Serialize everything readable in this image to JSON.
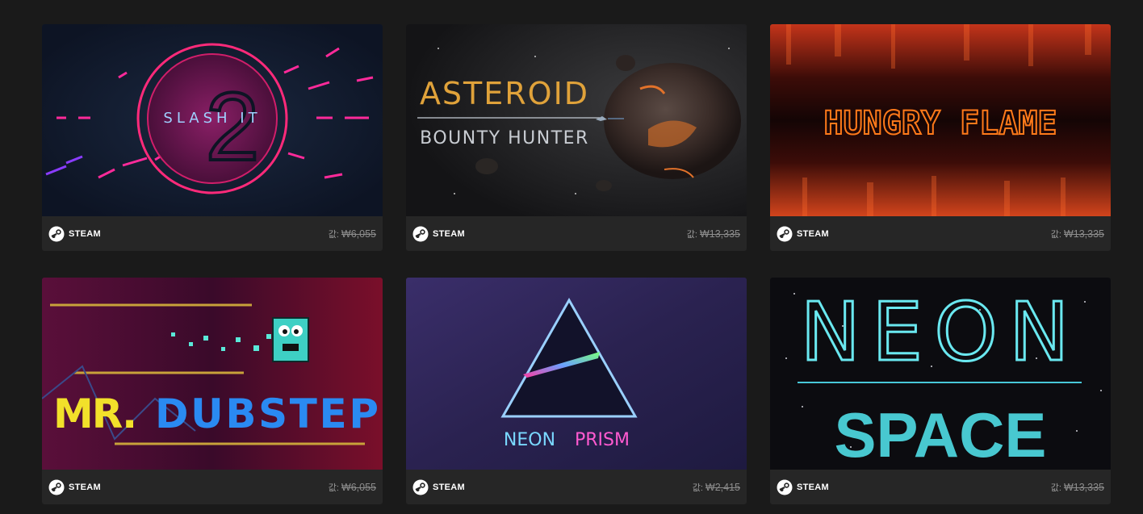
{
  "products": [
    {
      "title": "SLASH IT 2",
      "platform": "STEAM",
      "price_label": "값:",
      "price": "₩6,055"
    },
    {
      "title": "ASTEROID BOUNTY HUNTER",
      "platform": "STEAM",
      "price_label": "값:",
      "price": "₩13,335"
    },
    {
      "title": "HUNGRY FLAME",
      "platform": "STEAM",
      "price_label": "값:",
      "price": "₩13,335"
    },
    {
      "title": "MR. DUBSTEP",
      "platform": "STEAM",
      "price_label": "값:",
      "price": "₩6,055"
    },
    {
      "title": "NEON PRISM",
      "platform": "STEAM",
      "price_label": "값:",
      "price": "₩2,415"
    },
    {
      "title": "NEON SPACE",
      "platform": "STEAM",
      "price_label": "값:",
      "price": "₩13,335"
    }
  ],
  "art_text": {
    "slash_it": {
      "line1": "SLASH IT",
      "numeral": "2"
    },
    "asteroid": {
      "line1": "ASTEROID",
      "line2": "BOUNTY HUNTER"
    },
    "hungry_flame": {
      "line1": "HUNGRY FLAME"
    },
    "mr_dubstep": {
      "part1": "MR.",
      "part2": "DUBSTEP"
    },
    "neon_prism": {
      "part1": "NEON",
      "part2": "PRISM"
    },
    "neon_space": {
      "line1": "NEON",
      "line2": "SPACE"
    }
  },
  "icons": {
    "platform_icon": "steam-logo-icon"
  },
  "colors": {
    "background": "#1a1a1a",
    "card": "#262626",
    "price": "#8c8c8c"
  }
}
